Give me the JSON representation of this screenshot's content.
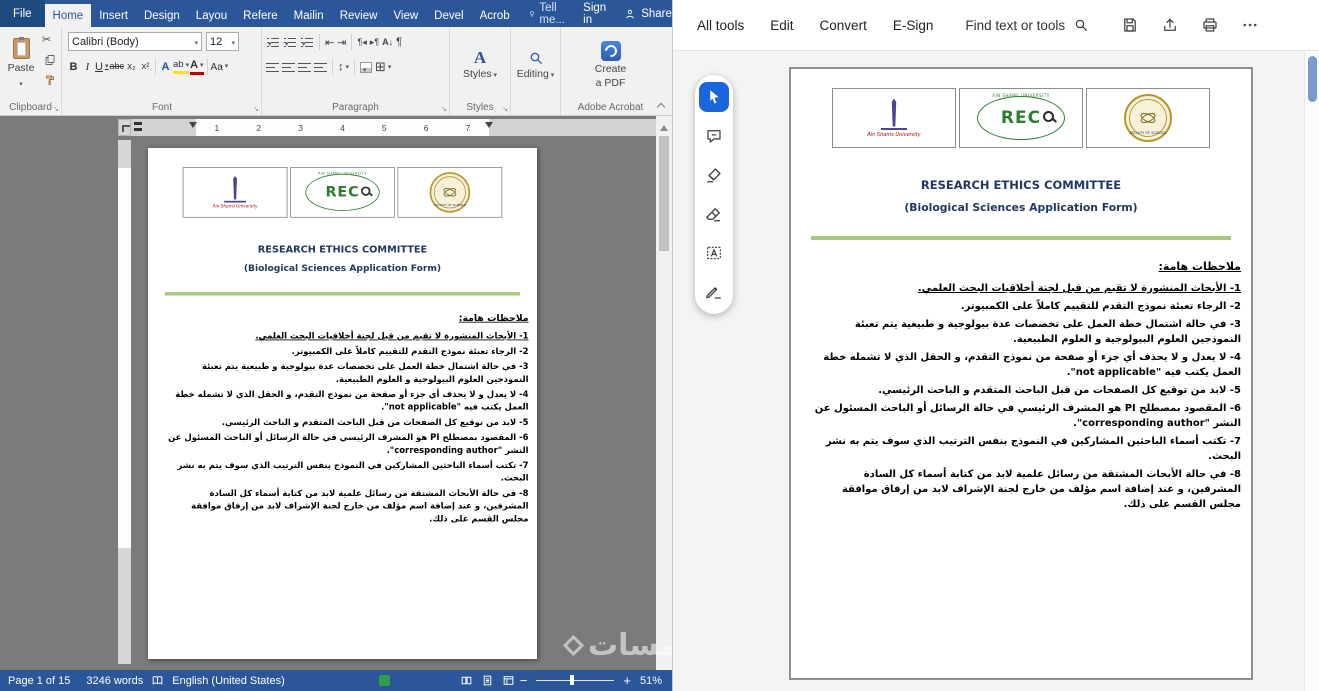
{
  "word": {
    "titlebar": {
      "tabs": [
        "File",
        "Home",
        "Insert",
        "Design",
        "Layou",
        "Refere",
        "Mailin",
        "Review",
        "View",
        "Devel",
        "Acrob"
      ],
      "active_tab": "Home",
      "tell_me": "Tell me...",
      "sign_in": "Sign in",
      "share": "Share"
    },
    "ribbon": {
      "paste_label": "Paste",
      "font_name": "Calibri (Body)",
      "font_size": "12",
      "font_buttons": [
        "B",
        "I",
        "U",
        "abc",
        "x₂",
        "x²",
        "A",
        "ab",
        "A",
        "Aa"
      ],
      "styles_label": "Styles",
      "editing_label": "Editing",
      "create_pdf_line1": "Create",
      "create_pdf_line2": "a PDF",
      "group_labels": {
        "clipboard": "Clipboard",
        "font": "Font",
        "paragraph": "Paragraph",
        "styles": "Styles",
        "adobe": "Adobe Acrobat"
      }
    },
    "ruler_numbers": [
      "1",
      "2",
      "3",
      "4",
      "5",
      "6",
      "7"
    ],
    "status_bar": {
      "page": "Page 1 of 15",
      "words": "3246 words",
      "language": "English (United States)",
      "zoom": "51%"
    },
    "watermark": "خمسات"
  },
  "acrobat": {
    "menu": [
      "All tools",
      "Edit",
      "Convert",
      "E-Sign"
    ],
    "find_label": "Find text or tools",
    "topbar_icons": [
      "save",
      "share-upload",
      "print",
      "more-options"
    ],
    "tools": [
      "select",
      "add-comment",
      "highlight",
      "eraser",
      "add-text",
      "fill-and-sign"
    ],
    "selected_tool": "select"
  },
  "document": {
    "title": "RESEARCH ETHICS COMMITTEE",
    "subtitle": "(Biological Sciences Application Form)",
    "notes_heading": "ملاحظات هامة:",
    "notes": [
      "1- الأبحاث المنشورة لا تقيم من قبل لجنة أخلاقيات البحث العلمي.",
      "2- الرجاء تعبئة نموذج التقدم للتقييم كاملاً على الكمبيوتر.",
      "3- في حالة اشتمال خطة العمل على تخصصات عدة بيولوجية و طبيعية يتم تعبئة النموذجين العلوم البيولوجية و العلوم الطبيعية.",
      "4- لا يعدل و لا يحذف أي جزء أو صفحة من نموذج التقدم، و الحقل الذي لا تشمله خطة العمل يكتب فيه \"not applicable\".",
      "5- لابد من توقيع كل الصفحات من قبل الباحث المتقدم و الباحث الرئيسي.",
      "6- المقصود بمصطلح PI هو المشرف الرئيسي في حالة الرسائل أو الباحث المسئول عن النشر \"corresponding author\".",
      "7- تكتب أسماء الباحثين المشاركين في النموذج بنفس الترتيب الذي سوف يتم به نشر البحث.",
      "8- في حالة الأبحاث المشتقة من رسائل علمية لابد من كتابة أسماء كل السادة المشرفين، و عند إضافة اسم مؤلف من خارج لجنة الإشراف لابد من إرفاق موافقة مجلس القسم على ذلك."
    ],
    "logos": {
      "university_caption": "Ain Shams University",
      "rec_text": "REC",
      "rec_caption": "AIN SHAMS UNIVERSITY",
      "faculty_caption": "FACULTY OF SCIENCE"
    },
    "colors": {
      "title_blue": "#1f3864",
      "rule_green": "#a5c87a",
      "word_theme_blue": "#2b579a",
      "acrobat_selected_blue": "#1a66dd"
    }
  },
  "icons": {
    "dropdown": "▾",
    "scissors": "✂",
    "decrease_indent": "⇤",
    "increase_indent": "⇥",
    "sort": "A↓",
    "pilcrow": "¶",
    "line_spacing": "↕",
    "borders": "⊞",
    "dialog_launcher": "↘"
  }
}
